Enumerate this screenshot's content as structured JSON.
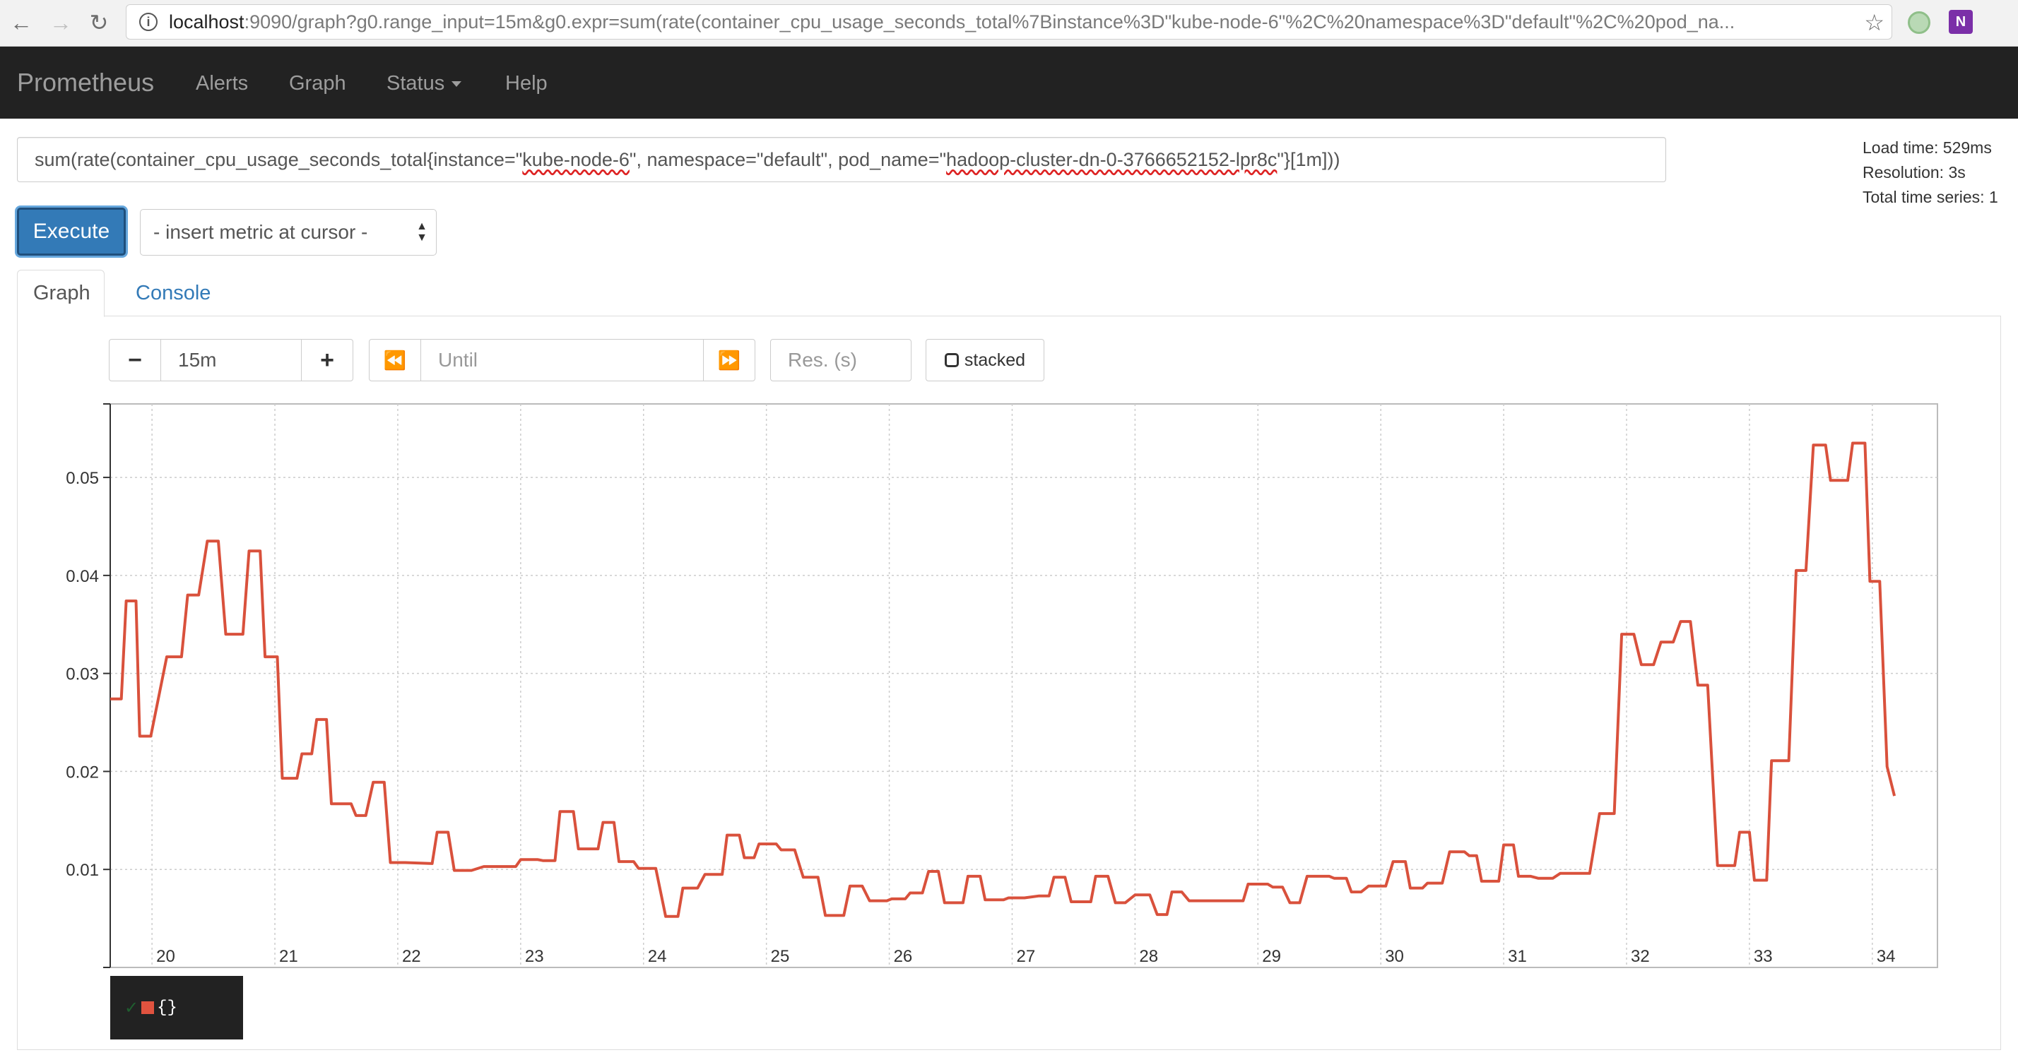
{
  "browser": {
    "url_host": "localhost",
    "url_rest": ":9090/graph?g0.range_input=15m&g0.expr=sum(rate(container_cpu_usage_seconds_total%7Binstance%3D\"kube-node-6\"%2C%20namespace%3D\"default\"%2C%20pod_na...",
    "ext_label": "N"
  },
  "navbar": {
    "brand": "Prometheus",
    "links": [
      "Alerts",
      "Graph",
      "Status",
      "Help"
    ]
  },
  "query": {
    "expr_part1": "sum(rate(container_cpu_usage_seconds_total{instance=\"",
    "expr_node": "kube-node-6",
    "expr_part2": "\", namespace=\"default\", pod_name=\"",
    "expr_pod": "hadoop-cluster-dn-0-3766652152-lpr8c",
    "expr_part3": "\"}[1m]))",
    "load_time": "Load time: 529ms",
    "resolution": "Resolution: 3s",
    "total_series": "Total time series: 1",
    "execute_label": "Execute",
    "metric_select": "- insert metric at cursor -"
  },
  "tabs": {
    "graph": "Graph",
    "console": "Console"
  },
  "controls": {
    "minus": "−",
    "range": "15m",
    "plus": "+",
    "back": "⏪",
    "until_placeholder": "Until",
    "forward": "⏩",
    "res_placeholder": "Res. (s)",
    "stacked": "stacked"
  },
  "legend": {
    "check": "✓",
    "label": "{}"
  },
  "colors": {
    "series": "#d9513c",
    "navbar": "#222222",
    "execute": "#337ab7"
  },
  "chart_data": {
    "type": "line",
    "xlabel": "",
    "ylabel": "",
    "x_ticks": [
      "20",
      "21",
      "22",
      "23",
      "24",
      "25",
      "26",
      "27",
      "28",
      "29",
      "30",
      "31",
      "32",
      "33",
      "34"
    ],
    "xlim": [
      19.66,
      34.53
    ],
    "y_ticks": [
      "0.01",
      "0.02",
      "0.03",
      "0.04",
      "0.05"
    ],
    "ylim": [
      0,
      0.0575
    ],
    "grid": true,
    "series": [
      {
        "values": [
          [
            19.66,
            0.0274
          ],
          [
            19.75,
            0.0274
          ],
          [
            19.79,
            0.0374
          ],
          [
            19.87,
            0.0374
          ],
          [
            19.9,
            0.0236
          ],
          [
            19.99,
            0.0236
          ],
          [
            20.12,
            0.0317
          ],
          [
            20.24,
            0.0317
          ],
          [
            20.29,
            0.038
          ],
          [
            20.38,
            0.038
          ],
          [
            20.45,
            0.0435
          ],
          [
            20.54,
            0.0435
          ],
          [
            20.6,
            0.034
          ],
          [
            20.74,
            0.034
          ],
          [
            20.79,
            0.0425
          ],
          [
            20.88,
            0.0425
          ],
          [
            20.92,
            0.0317
          ],
          [
            21.02,
            0.0317
          ],
          [
            21.06,
            0.0193
          ],
          [
            21.18,
            0.0193
          ],
          [
            21.22,
            0.0218
          ],
          [
            21.3,
            0.0218
          ],
          [
            21.34,
            0.0253
          ],
          [
            21.42,
            0.0253
          ],
          [
            21.46,
            0.0167
          ],
          [
            21.62,
            0.0167
          ],
          [
            21.66,
            0.0155
          ],
          [
            21.74,
            0.0155
          ],
          [
            21.8,
            0.0189
          ],
          [
            21.89,
            0.0189
          ],
          [
            21.94,
            0.0107
          ],
          [
            22.06,
            0.0107
          ],
          [
            22.28,
            0.0106
          ],
          [
            22.32,
            0.0138
          ],
          [
            22.41,
            0.0138
          ],
          [
            22.46,
            0.0099
          ],
          [
            22.6,
            0.0099
          ],
          [
            22.7,
            0.0103
          ],
          [
            22.96,
            0.0103
          ],
          [
            23.0,
            0.011
          ],
          [
            23.14,
            0.011
          ],
          [
            23.18,
            0.0109
          ],
          [
            23.28,
            0.0109
          ],
          [
            23.32,
            0.0159
          ],
          [
            23.43,
            0.0159
          ],
          [
            23.47,
            0.0121
          ],
          [
            23.63,
            0.0121
          ],
          [
            23.67,
            0.0148
          ],
          [
            23.76,
            0.0148
          ],
          [
            23.8,
            0.0108
          ],
          [
            23.92,
            0.0108
          ],
          [
            23.96,
            0.0101
          ],
          [
            24.1,
            0.0101
          ],
          [
            24.18,
            0.0052
          ],
          [
            24.28,
            0.0052
          ],
          [
            24.32,
            0.0081
          ],
          [
            24.44,
            0.0081
          ],
          [
            24.5,
            0.0095
          ],
          [
            24.64,
            0.0095
          ],
          [
            24.68,
            0.0135
          ],
          [
            24.78,
            0.0135
          ],
          [
            24.82,
            0.0112
          ],
          [
            24.9,
            0.0112
          ],
          [
            24.94,
            0.0126
          ],
          [
            25.08,
            0.0126
          ],
          [
            25.12,
            0.012
          ],
          [
            25.23,
            0.012
          ],
          [
            25.3,
            0.0092
          ],
          [
            25.42,
            0.0092
          ],
          [
            25.48,
            0.0053
          ],
          [
            25.63,
            0.0053
          ],
          [
            25.68,
            0.0083
          ],
          [
            25.78,
            0.0083
          ],
          [
            25.84,
            0.0068
          ],
          [
            25.98,
            0.0068
          ],
          [
            26.02,
            0.007
          ],
          [
            26.13,
            0.007
          ],
          [
            26.17,
            0.0076
          ],
          [
            26.27,
            0.0076
          ],
          [
            26.32,
            0.0098
          ],
          [
            26.4,
            0.0098
          ],
          [
            26.45,
            0.0066
          ],
          [
            26.6,
            0.0066
          ],
          [
            26.64,
            0.0093
          ],
          [
            26.74,
            0.0093
          ],
          [
            26.78,
            0.0069
          ],
          [
            26.93,
            0.0069
          ],
          [
            26.97,
            0.0071
          ],
          [
            27.1,
            0.0071
          ],
          [
            27.22,
            0.0073
          ],
          [
            27.3,
            0.0073
          ],
          [
            27.34,
            0.0092
          ],
          [
            27.43,
            0.0092
          ],
          [
            27.48,
            0.0067
          ],
          [
            27.64,
            0.0067
          ],
          [
            27.68,
            0.0093
          ],
          [
            27.78,
            0.0093
          ],
          [
            27.84,
            0.0066
          ],
          [
            27.92,
            0.0066
          ],
          [
            28.0,
            0.0074
          ],
          [
            28.12,
            0.0074
          ],
          [
            28.18,
            0.0054
          ],
          [
            28.26,
            0.0054
          ],
          [
            28.3,
            0.0077
          ],
          [
            28.38,
            0.0077
          ],
          [
            28.44,
            0.0068
          ],
          [
            28.88,
            0.0068
          ],
          [
            28.92,
            0.0085
          ],
          [
            29.08,
            0.0085
          ],
          [
            29.12,
            0.0082
          ],
          [
            29.2,
            0.0082
          ],
          [
            29.26,
            0.0066
          ],
          [
            29.34,
            0.0066
          ],
          [
            29.4,
            0.0093
          ],
          [
            29.58,
            0.0093
          ],
          [
            29.62,
            0.0091
          ],
          [
            29.72,
            0.0091
          ],
          [
            29.76,
            0.0077
          ],
          [
            29.84,
            0.0077
          ],
          [
            29.9,
            0.0083
          ],
          [
            30.04,
            0.0083
          ],
          [
            30.1,
            0.0108
          ],
          [
            30.2,
            0.0108
          ],
          [
            30.24,
            0.0081
          ],
          [
            30.34,
            0.0081
          ],
          [
            30.38,
            0.0086
          ],
          [
            30.5,
            0.0086
          ],
          [
            30.56,
            0.0118
          ],
          [
            30.68,
            0.0118
          ],
          [
            30.72,
            0.0114
          ],
          [
            30.78,
            0.0114
          ],
          [
            30.82,
            0.0088
          ],
          [
            30.96,
            0.0088
          ],
          [
            31.0,
            0.0125
          ],
          [
            31.08,
            0.0125
          ],
          [
            31.12,
            0.0093
          ],
          [
            31.22,
            0.0093
          ],
          [
            31.28,
            0.0091
          ],
          [
            31.4,
            0.0091
          ],
          [
            31.46,
            0.0096
          ],
          [
            31.7,
            0.0096
          ],
          [
            31.78,
            0.0157
          ],
          [
            31.9,
            0.0157
          ],
          [
            31.96,
            0.034
          ],
          [
            32.06,
            0.034
          ],
          [
            32.12,
            0.0309
          ],
          [
            32.22,
            0.0309
          ],
          [
            32.28,
            0.0332
          ],
          [
            32.38,
            0.0332
          ],
          [
            32.44,
            0.0353
          ],
          [
            32.52,
            0.0353
          ],
          [
            32.58,
            0.0288
          ],
          [
            32.66,
            0.0288
          ],
          [
            32.74,
            0.0104
          ],
          [
            32.88,
            0.0104
          ],
          [
            32.92,
            0.0138
          ],
          [
            33.0,
            0.0138
          ],
          [
            33.04,
            0.0089
          ],
          [
            33.14,
            0.0089
          ],
          [
            33.18,
            0.0211
          ],
          [
            33.32,
            0.0211
          ],
          [
            33.38,
            0.0405
          ],
          [
            33.46,
            0.0405
          ],
          [
            33.52,
            0.0533
          ],
          [
            33.62,
            0.0533
          ],
          [
            33.66,
            0.0497
          ],
          [
            33.8,
            0.0497
          ],
          [
            33.84,
            0.0535
          ],
          [
            33.94,
            0.0535
          ],
          [
            33.98,
            0.0394
          ],
          [
            34.06,
            0.0394
          ],
          [
            34.12,
            0.0205
          ],
          [
            34.18,
            0.0175
          ]
        ]
      }
    ]
  }
}
